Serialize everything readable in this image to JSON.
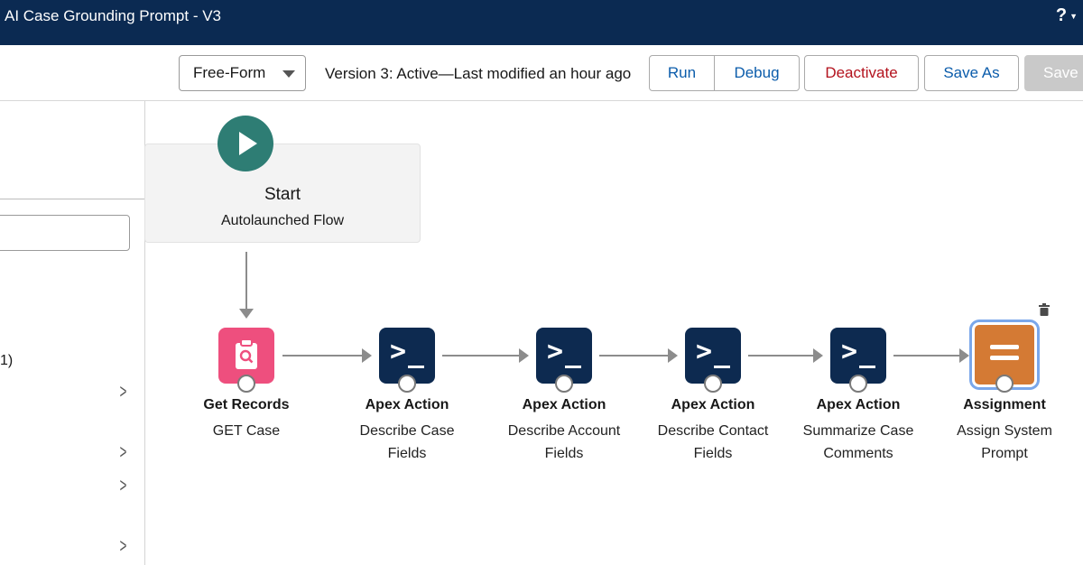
{
  "window": {
    "title": "AI Case Grounding Prompt - V3",
    "help_icon": "question-icon"
  },
  "toolbar": {
    "flow_type": "Free-Form",
    "version_text": "Version 3: Active—Last modified an hour ago",
    "run_label": "Run",
    "debug_label": "Debug",
    "deactivate_label": "Deactivate",
    "save_as_label": "Save As",
    "save_label": "Save"
  },
  "left_panel": {
    "partial_text": "1)"
  },
  "canvas": {
    "start": {
      "title": "Start",
      "subtitle": "Autolaunched Flow"
    },
    "nodes": [
      {
        "type": "Get Records",
        "name": "GET Case",
        "icon": "search-records-icon"
      },
      {
        "type": "Apex Action",
        "name": "Describe Case Fields",
        "icon": "terminal-icon"
      },
      {
        "type": "Apex Action",
        "name": "Describe Account Fields",
        "icon": "terminal-icon"
      },
      {
        "type": "Apex Action",
        "name": "Describe Contact Fields",
        "icon": "terminal-icon"
      },
      {
        "type": "Apex Action",
        "name": "Summarize Case Comments",
        "icon": "terminal-icon"
      },
      {
        "type": "Assignment",
        "name": "Assign System Prompt",
        "icon": "assignment-icon"
      }
    ]
  },
  "colors": {
    "header": "#0b2a52",
    "start": "#2e7d74",
    "get_records": "#ee4f7e",
    "apex": "#0d2a50",
    "assignment": "#d47a34",
    "link_blue": "#0b5cab",
    "destructive_red": "#b3121d"
  }
}
